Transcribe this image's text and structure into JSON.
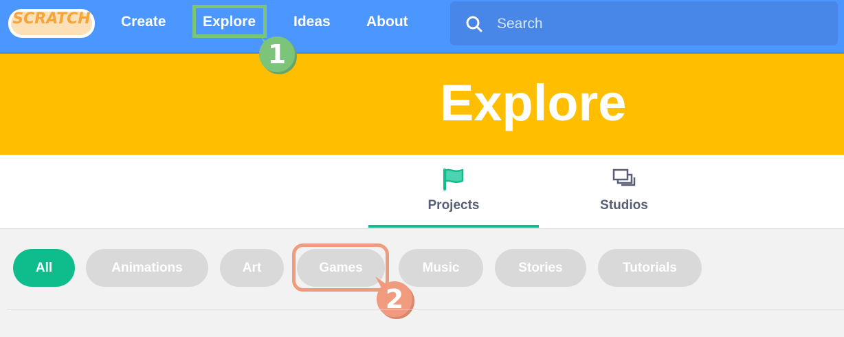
{
  "nav": {
    "logo": "SCRATCH",
    "links": [
      "Create",
      "Explore",
      "Ideas",
      "About"
    ],
    "search_placeholder": "Search",
    "search_icon": "search-icon"
  },
  "banner": {
    "title": "Explore"
  },
  "tabs": [
    {
      "label": "Projects",
      "icon": "flag-icon",
      "active": true
    },
    {
      "label": "Studios",
      "icon": "studios-icon",
      "active": false
    }
  ],
  "filters": [
    "All",
    "Animations",
    "Art",
    "Games",
    "Music",
    "Stories",
    "Tutorials"
  ],
  "active_filter": "All",
  "markers": [
    "1",
    "2"
  ],
  "colors": {
    "nav": "#4c97ff",
    "banner": "#ffbf00",
    "accent": "#0fbd8c",
    "pill": "#d9d9d9",
    "marker1": "#7cc47a",
    "marker2": "#f19b7e"
  }
}
